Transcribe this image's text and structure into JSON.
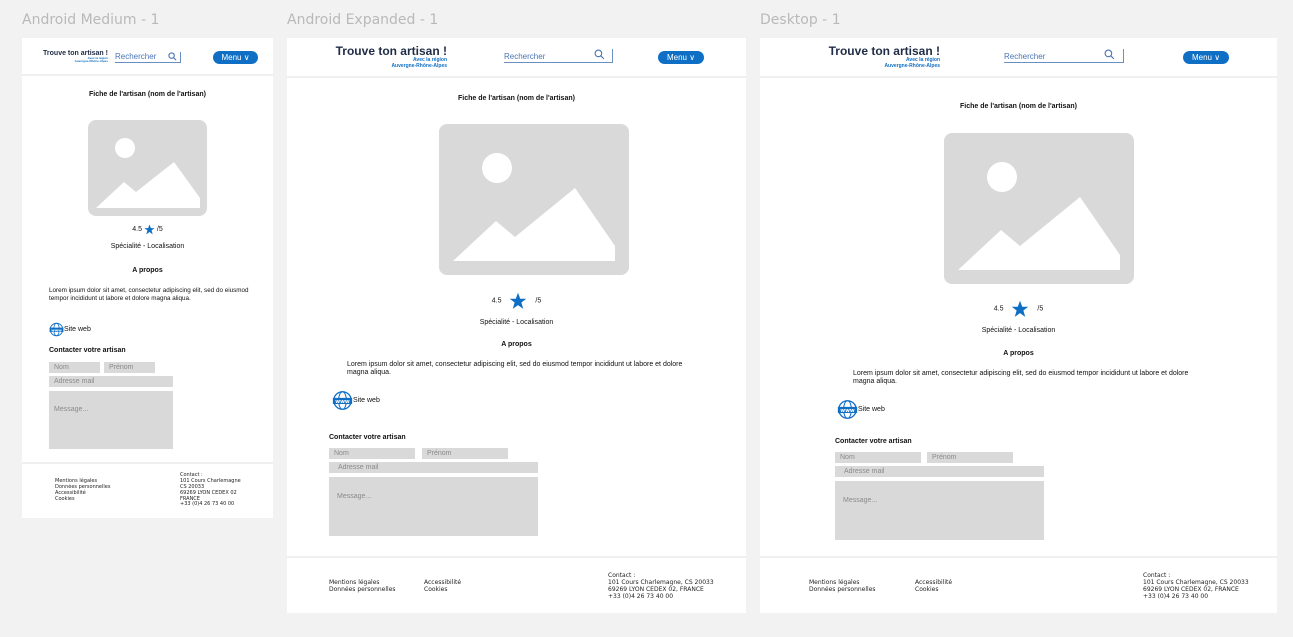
{
  "frames": {
    "medium": {
      "label": "Android Medium - 1"
    },
    "expanded": {
      "label": "Android Expanded - 1"
    },
    "desktop": {
      "label": "Desktop - 1"
    }
  },
  "header": {
    "logo_title": "Trouve ton artisan !",
    "logo_sub1": "Avec la région",
    "logo_sub2": "Auvergne-Rhône-Alpes",
    "search_placeholder": "Rechercher",
    "menu_label": "Menu ∨"
  },
  "page": {
    "title": "Fiche de l'artisan (nom de l'artisan)",
    "rating_value": "4.5",
    "rating_max": "/5",
    "specialty": "Spécialité - Localisation",
    "about_title": "A propos",
    "about_text": "Lorem ipsum dolor sit amet, consectetur adipiscing elit, sed do eiusmod tempor incididunt ut labore et dolore magna aliqua.",
    "website_label": "Site web"
  },
  "contact_form": {
    "title": "Contacter votre artisan",
    "nom_placeholder": "Nom",
    "prenom_placeholder": "Prénom",
    "email_placeholder": "Adresse mail",
    "message_placeholder": "Message..."
  },
  "footer": {
    "links": [
      "Mentions légales",
      "Données personnelles",
      "Accessibilité",
      "Cookies"
    ],
    "contact_label": "Contact :",
    "address_full": "101 Cours Charlemagne, CS 20033",
    "address_line1": "101 Cours Charlemagne",
    "address_line2": "CS 20033",
    "city_full": "69269 LYON CEDEX 02, FRANCE",
    "city": "69269 LYON CEDEX 02",
    "country": "FRANCE",
    "phone": "+33 (0)4 26 73 40 00"
  },
  "colors": {
    "accent": "#0f6fc5",
    "navy": "#1f2c45",
    "placeholder_grey": "#d9d9d9",
    "background": "#f2f2f2"
  },
  "icons": [
    "search-icon",
    "image-placeholder-icon",
    "star-icon",
    "globe-www-icon"
  ]
}
